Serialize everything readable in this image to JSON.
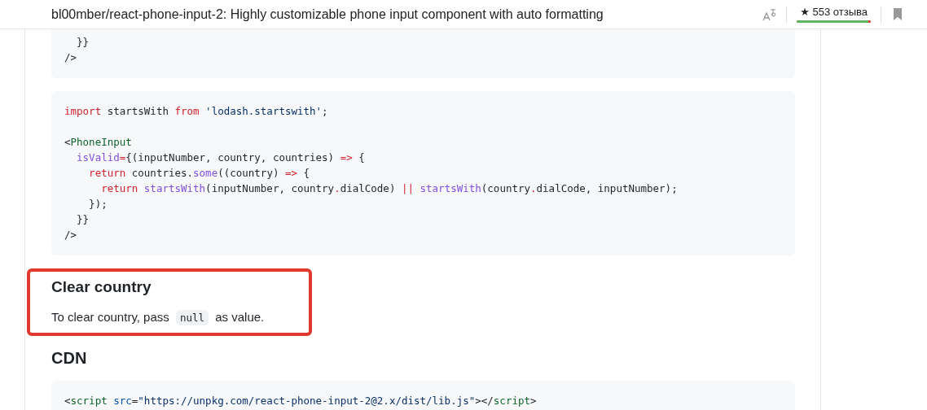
{
  "header": {
    "title": "bl00mber/react-phone-input-2: Highly customizable phone input component with auto formatting",
    "reviews": {
      "label": "★ 553 отзыва",
      "level": 0.97
    }
  },
  "sections": [
    {
      "kind": "code",
      "groups": [
        [
          {
            "tokens": [
              {
                "text": "  }}",
                "kind": "plain"
              }
            ]
          },
          {
            "tokens": [
              {
                "text": "/>",
                "kind": "plain"
              }
            ]
          }
        ]
      ]
    },
    {
      "kind": "code",
      "groups": [
        [
          {
            "tokens": [
              {
                "text": "import",
                "kind": "keyword"
              },
              {
                "text": " startsWith ",
                "kind": "plain"
              },
              {
                "text": "from",
                "kind": "keyword"
              },
              {
                "text": " 'lodash.startswith'",
                "kind": "string"
              },
              {
                "text": ";",
                "kind": "plain"
              }
            ]
          }
        ],
        [
          {
            "tokens": [
              {
                "text": "<",
                "kind": "plain"
              },
              {
                "text": "PhoneInput",
                "kind": "tag"
              }
            ]
          },
          {
            "tokens": [
              {
                "text": "  isValid",
                "kind": "entity"
              },
              {
                "text": "=",
                "kind": "keyword"
              },
              {
                "text": "{(inputNumber, country, countries) ",
                "kind": "plain"
              },
              {
                "text": "=>",
                "kind": "keyword"
              },
              {
                "text": " {",
                "kind": "plain"
              }
            ]
          },
          {
            "tokens": [
              {
                "text": "    return",
                "kind": "keyword"
              },
              {
                "text": " countries.",
                "kind": "plain"
              },
              {
                "text": "some",
                "kind": "entity"
              },
              {
                "text": "((country) ",
                "kind": "plain"
              },
              {
                "text": "=>",
                "kind": "keyword"
              },
              {
                "text": " {",
                "kind": "plain"
              }
            ]
          },
          {
            "tokens": [
              {
                "text": "      return",
                "kind": "keyword"
              },
              {
                "text": " startsWith",
                "kind": "entity"
              },
              {
                "text": "(inputNumber, country",
                "kind": "plain"
              },
              {
                "text": ".",
                "kind": "keyword"
              },
              {
                "text": "dialCode) ",
                "kind": "plain"
              },
              {
                "text": "||",
                "kind": "keyword"
              },
              {
                "text": " startsWith",
                "kind": "entity"
              },
              {
                "text": "(country",
                "kind": "plain"
              },
              {
                "text": ".",
                "kind": "keyword"
              },
              {
                "text": "dialCode, inputNumber);",
                "kind": "plain"
              }
            ]
          },
          {
            "tokens": [
              {
                "text": "    });",
                "kind": "plain"
              }
            ]
          },
          {
            "tokens": [
              {
                "text": "  }}",
                "kind": "plain"
              }
            ]
          },
          {
            "tokens": [
              {
                "text": "/>",
                "kind": "plain"
              }
            ]
          }
        ]
      ]
    },
    {
      "kind": "highlight",
      "heading": "Clear country",
      "text_before": "To clear country, pass",
      "code": "null",
      "text_after": "as value."
    },
    {
      "kind": "heading",
      "heading": "CDN"
    },
    {
      "kind": "code",
      "groups": [
        [
          {
            "tokens": [
              {
                "text": "<",
                "kind": "plain"
              },
              {
                "text": "script",
                "kind": "tag"
              },
              {
                "text": " src",
                "kind": "constant"
              },
              {
                "text": "=",
                "kind": "plain"
              },
              {
                "text": "\"https://unpkg.com/react-phone-input-2@2.x/dist/lib.js\"",
                "kind": "string"
              },
              {
                "text": "></",
                "kind": "plain"
              },
              {
                "text": "script",
                "kind": "tag"
              },
              {
                "text": ">",
                "kind": "plain"
              }
            ]
          }
        ]
      ]
    }
  ]
}
